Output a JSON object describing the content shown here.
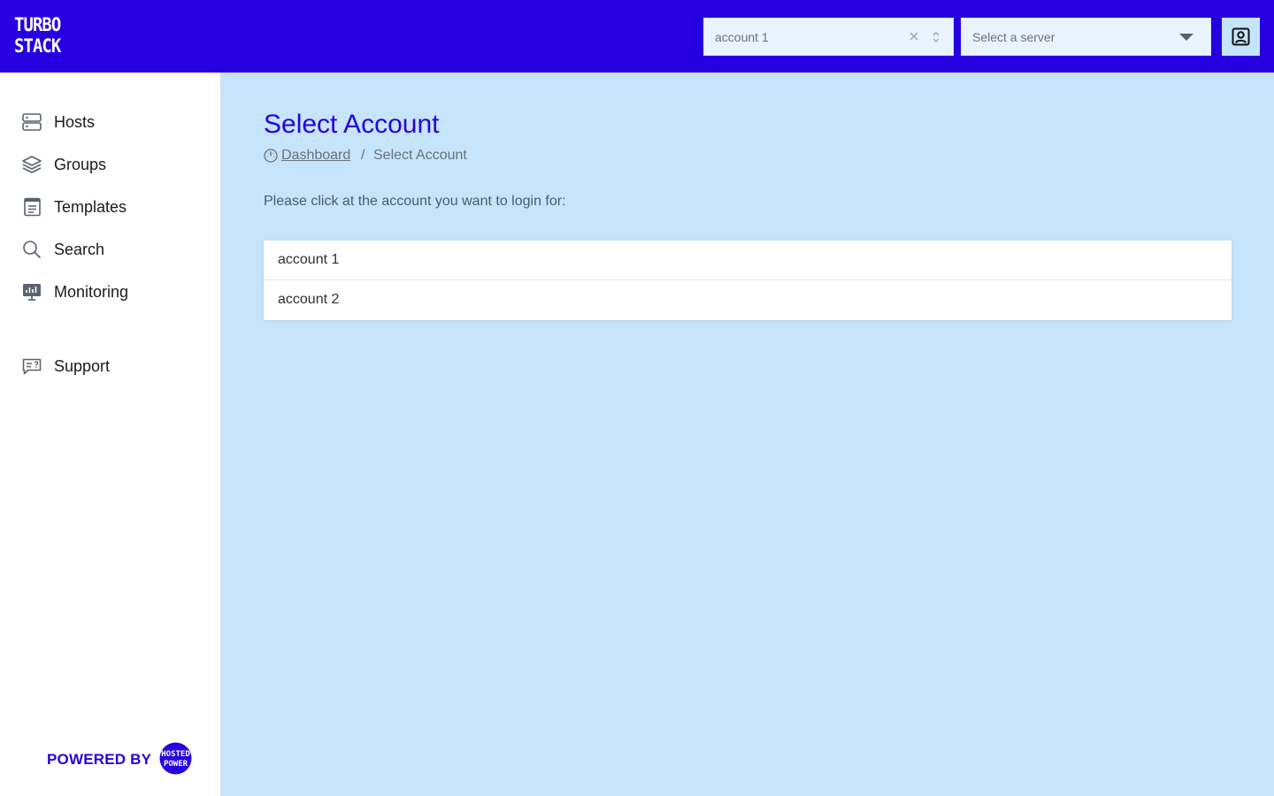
{
  "brand": {
    "logo_line1": "TURBO",
    "logo_line2": "STACK",
    "header_color": "#2600e0"
  },
  "header": {
    "account_select": {
      "value": "account 1",
      "clear_icon": "close-icon",
      "toggle_icon": "chevron-up-down-icon"
    },
    "server_select": {
      "placeholder": "Select a server",
      "toggle_icon": "caret-down-icon"
    },
    "profile_icon": "user-profile-icon"
  },
  "sidebar": {
    "items": [
      {
        "label": "Hosts",
        "icon": "server-icon"
      },
      {
        "label": "Groups",
        "icon": "layers-icon"
      },
      {
        "label": "Templates",
        "icon": "document-icon"
      },
      {
        "label": "Search",
        "icon": "search-icon"
      },
      {
        "label": "Monitoring",
        "icon": "monitor-icon"
      },
      {
        "label": "Support",
        "icon": "support-chat-icon"
      }
    ],
    "footer": {
      "powered_by": "POWERED BY",
      "partner_logo_text": "HOSTED POWER"
    }
  },
  "main": {
    "title": "Select Account",
    "breadcrumb": {
      "home": "Dashboard",
      "separator": "/",
      "current": "Select Account"
    },
    "instructions": "Please click at the account you want to login for:",
    "accounts": [
      "account 1",
      "account 2"
    ]
  },
  "colors": {
    "accent": "#2600e0",
    "background": "#c6e5fd",
    "sidebar": "#ffffff"
  }
}
